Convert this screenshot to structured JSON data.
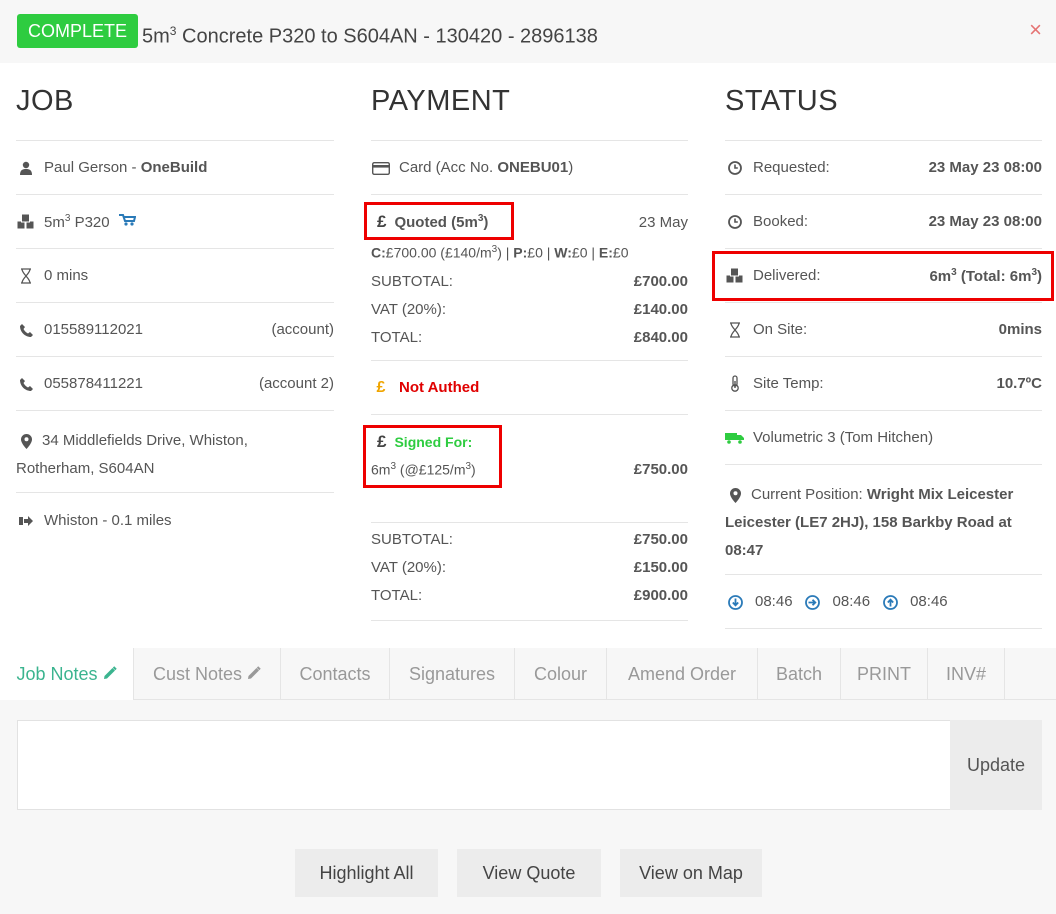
{
  "header": {
    "status_badge": "COMPLETE",
    "title_prefix": "5m",
    "title_sup": "3",
    "title_rest": " Concrete P320 to S604AN - 130420 - 2896138",
    "close": "×"
  },
  "job": {
    "heading": "JOB",
    "customer_name": "Paul Gerson - ",
    "customer_company": "OneBuild",
    "product_qty": "5m",
    "product_sup": "3",
    "product_rest": " P320",
    "duration": "0 mins",
    "phone1": "015589112021",
    "phone1_note": "(account)",
    "phone2": "055878411221",
    "phone2_note": "(account 2)",
    "address_line1": "34 Middlefields Drive, Whiston,",
    "address_line2": "Rotherham, S604AN",
    "location": "Whiston - 0.1 miles"
  },
  "payment": {
    "heading": "PAYMENT",
    "card_label": "Card (Acc No. ",
    "card_acc": "ONEBU01",
    "card_close": ")",
    "quoted_label": "Quoted (5m",
    "quoted_sup": "3",
    "quoted_close": ")",
    "quoted_date": "23 May",
    "breakdown_c_label": "C:",
    "breakdown_c": "£700.00 (£140/m",
    "breakdown_c_sup": "3",
    "breakdown_c_close": ")",
    "breakdown_p_label": "P:",
    "breakdown_p": "£0",
    "breakdown_w_label": "W:",
    "breakdown_w": "£0",
    "breakdown_e_label": "E:",
    "breakdown_e": "£0",
    "sep": " | ",
    "q_subtotal_label": "SUBTOTAL:",
    "q_subtotal": "£700.00",
    "q_vat_label": "VAT (20%):",
    "q_vat": "£140.00",
    "q_total_label": "TOTAL:",
    "q_total": "£840.00",
    "auth_status": "Not Authed",
    "signed_label": "Signed For:",
    "signed_qty": "6m",
    "signed_sup": "3",
    "signed_rate": " (@£125/m",
    "signed_rate_sup": "3",
    "signed_rate_close": ")",
    "signed_value": "£750.00",
    "s_subtotal_label": "SUBTOTAL:",
    "s_subtotal": "£750.00",
    "s_vat_label": "VAT (20%):",
    "s_vat": "£150.00",
    "s_total_label": "TOTAL:",
    "s_total": "£900.00",
    "pound": "£"
  },
  "status": {
    "heading": "STATUS",
    "requested_label": "Requested:",
    "requested": "23 May 23 08:00",
    "booked_label": "Booked:",
    "booked": "23 May 23 08:00",
    "delivered_label": "Delivered:",
    "delivered_a": "6m",
    "delivered_sup": "3",
    "delivered_b": " (Total: 6m",
    "delivered_sup2": "3",
    "delivered_c": ")",
    "onsite_label": "On Site:",
    "onsite": "0mins",
    "temp_label": "Site Temp:",
    "temp": "10.7ºC",
    "vehicle": "Volumetric 3 (Tom Hitchen)",
    "position_label": "Current Position: ",
    "position_bold1": "Wright Mix Leicester",
    "position_bold2": "Leicester (LE7 2HJ), 158 Barkby Road at",
    "position_bold3": "08:47",
    "time1": "08:46",
    "time2": "08:46",
    "time3": "08:46"
  },
  "tabs": [
    {
      "label": "Job Notes"
    },
    {
      "label": "Cust Notes"
    },
    {
      "label": "Contacts"
    },
    {
      "label": "Signatures"
    },
    {
      "label": "Colour"
    },
    {
      "label": "Amend Order"
    },
    {
      "label": "Batch"
    },
    {
      "label": "PRINT"
    },
    {
      "label": "INV#"
    }
  ],
  "notes": {
    "value": "",
    "update_label": "Update"
  },
  "actions": {
    "highlight_all": "Highlight All",
    "view_quote": "View Quote",
    "view_on_map": "View on Map"
  },
  "colors": {
    "complete_green": "#2ecc40",
    "active_tab": "#3bb48f",
    "highlight_red": "#e00000",
    "not_authed_red": "#e00000",
    "signed_green": "#2ecc40",
    "pound_gold": "#f0a500"
  }
}
